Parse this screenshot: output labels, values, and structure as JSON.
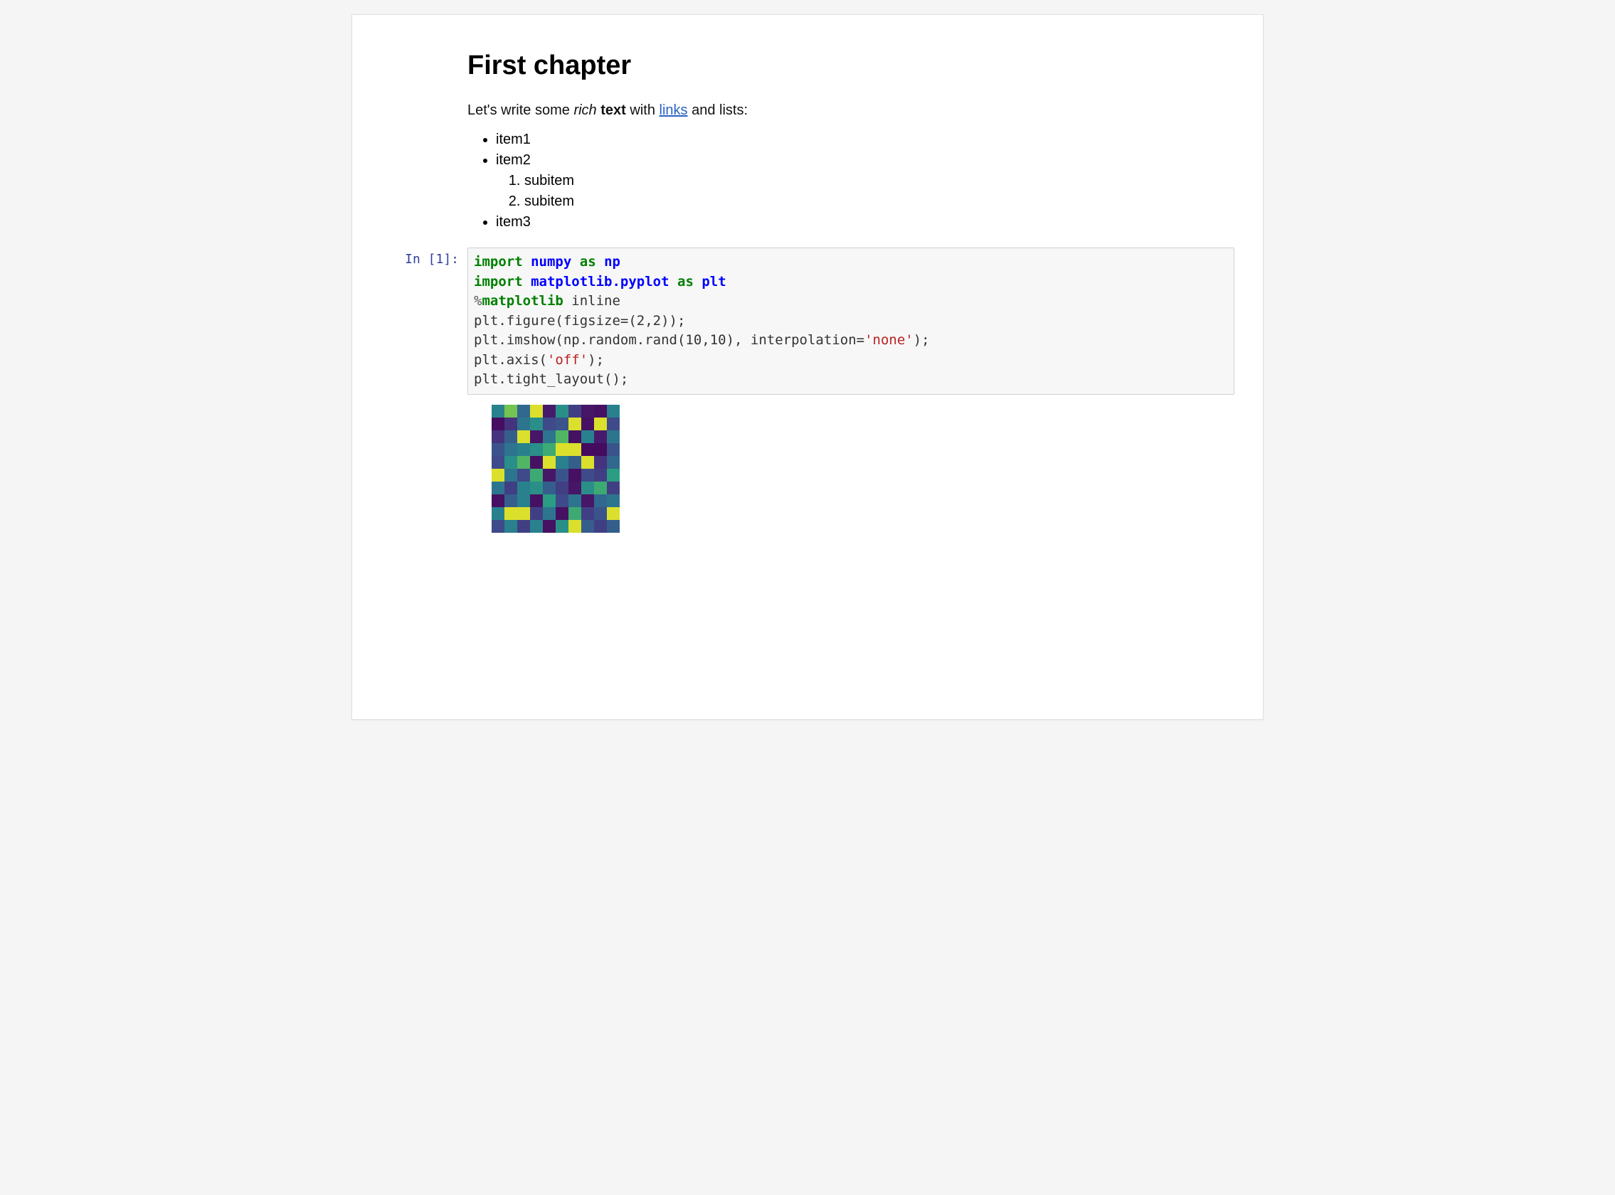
{
  "markdown": {
    "heading": "First chapter",
    "intro_prefix": "Let's write some ",
    "intro_em": "rich",
    "intro_space": " ",
    "intro_strong": "text",
    "intro_mid": " with ",
    "intro_link": "links",
    "intro_suffix": " and lists:",
    "list": {
      "item1": "item1",
      "item2": "item2",
      "sub1": "subitem",
      "sub2": "subitem",
      "item3": "item3"
    }
  },
  "code_cell": {
    "prompt": "In [1]:",
    "tokens": {
      "import1": "import",
      "numpy": "numpy",
      "as1": "as",
      "np": "np",
      "import2": "import",
      "mpl": "matplotlib.pyplot",
      "as2": "as",
      "plt": "plt",
      "pct": "%",
      "magic": "matplotlib",
      "inline": " inline",
      "line4": "plt.figure(figsize=(2,2));",
      "line5a": "plt.imshow(np.random.rand(10,10), interpolation=",
      "none_str": "'none'",
      "line5b": ");",
      "line6a": "plt.axis(",
      "off_str": "'off'",
      "line6b": ");",
      "line7": "plt.tight_layout();"
    }
  },
  "chart_data": {
    "type": "heatmap",
    "rows": 10,
    "cols": 10,
    "colormap": "viridis",
    "grid": [
      [
        0.55,
        0.8,
        0.45,
        0.95,
        0.1,
        0.6,
        0.25,
        0.08,
        0.06,
        0.55
      ],
      [
        0.05,
        0.2,
        0.5,
        0.6,
        0.3,
        0.35,
        0.95,
        0.06,
        0.95,
        0.3
      ],
      [
        0.2,
        0.4,
        0.95,
        0.08,
        0.5,
        0.75,
        0.06,
        0.55,
        0.1,
        0.5
      ],
      [
        0.35,
        0.5,
        0.55,
        0.6,
        0.7,
        0.95,
        0.95,
        0.04,
        0.04,
        0.35
      ],
      [
        0.3,
        0.6,
        0.75,
        0.06,
        0.95,
        0.55,
        0.4,
        0.95,
        0.2,
        0.45
      ],
      [
        0.95,
        0.5,
        0.3,
        0.7,
        0.08,
        0.35,
        0.06,
        0.3,
        0.25,
        0.65
      ],
      [
        0.5,
        0.25,
        0.55,
        0.6,
        0.4,
        0.25,
        0.08,
        0.6,
        0.7,
        0.25
      ],
      [
        0.06,
        0.4,
        0.55,
        0.06,
        0.65,
        0.3,
        0.5,
        0.08,
        0.45,
        0.5
      ],
      [
        0.55,
        0.95,
        0.95,
        0.25,
        0.5,
        0.06,
        0.7,
        0.25,
        0.35,
        0.95
      ],
      [
        0.3,
        0.55,
        0.25,
        0.55,
        0.06,
        0.6,
        0.95,
        0.4,
        0.25,
        0.4
      ]
    ]
  }
}
